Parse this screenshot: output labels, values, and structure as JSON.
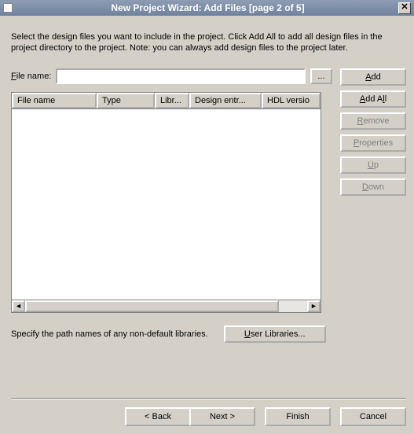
{
  "window": {
    "title": "New Project Wizard: Add Files [page 2 of 5]",
    "close_glyph": "✕"
  },
  "description": "Select the design files you want to include in the project. Click Add All to add all design files in the project directory to the project. Note: you can always add design files to the project later.",
  "filename": {
    "label_pre": "F",
    "label_rest": "ile name:",
    "value": "",
    "browse_label": "..."
  },
  "side_buttons": {
    "add_pre": "A",
    "add_rest": "dd",
    "add_all_label": "Add All",
    "remove_pre": "R",
    "remove_rest": "emove",
    "properties_pre": "P",
    "properties_rest": "roperties",
    "up_pre": "U",
    "up_rest": "p",
    "down_pre": "D",
    "down_rest": "own"
  },
  "table": {
    "columns": {
      "file_name": "File name",
      "type": "Type",
      "lib": "Libr...",
      "design_entry": "Design entr...",
      "hdl_version": "HDL versio"
    },
    "rows": []
  },
  "scroll": {
    "left": "◄",
    "right": "►"
  },
  "libraries": {
    "note": "Specify the path names of any non-default libraries.",
    "button_pre": "U",
    "button_rest": "ser Libraries..."
  },
  "nav": {
    "back": "< Back",
    "next": "Next >",
    "finish": "Finish",
    "cancel": "Cancel"
  }
}
